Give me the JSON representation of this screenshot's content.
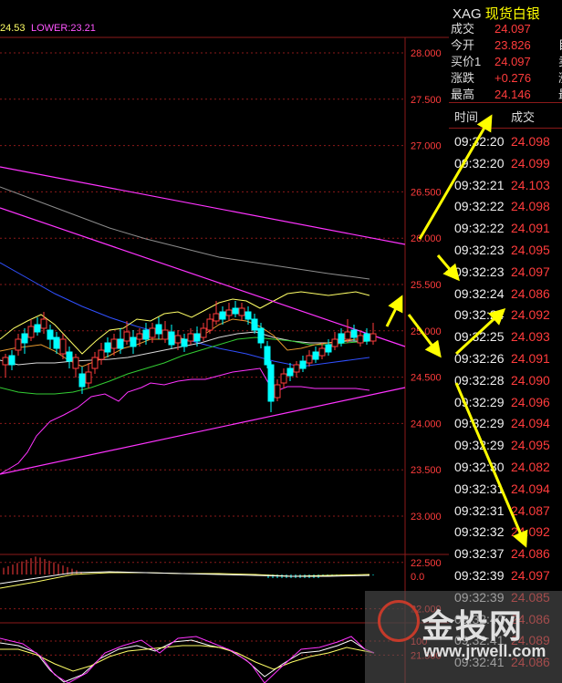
{
  "chart_top": {
    "ma_text_a": "24.53",
    "lower_text": "LOWER:23.21"
  },
  "price_axis": {
    "labels": [
      "28.000",
      "27.500",
      "27.000",
      "26.500",
      "26.000",
      "25.500",
      "25.000",
      "24.500",
      "24.000",
      "23.500",
      "23.000",
      "22.500",
      "22.000",
      "21.500",
      "21.000"
    ]
  },
  "macd_axis": {
    "zero_label": "0.0"
  },
  "kdj_axis": {
    "top_label": "100"
  },
  "quote": {
    "symbol": "XAG",
    "name": "现货白银",
    "rows": [
      {
        "label": "成交",
        "value": "24.097",
        "extra": ""
      },
      {
        "label": "今开",
        "value": "23.826",
        "extra": "目"
      },
      {
        "label": "买价1",
        "value": "24.097",
        "extra": "卖"
      },
      {
        "label": "涨跌",
        "value": "+0.276",
        "extra": "涨"
      },
      {
        "label": "最高",
        "value": "24.146",
        "extra": "最"
      }
    ]
  },
  "ticks": {
    "col_time": "时间",
    "col_price": "成交",
    "rows": [
      {
        "time": "09:32:20",
        "price": "24.098"
      },
      {
        "time": "09:32:20",
        "price": "24.099"
      },
      {
        "time": "09:32:21",
        "price": "24.103"
      },
      {
        "time": "09:32:22",
        "price": "24.098"
      },
      {
        "time": "09:32:22",
        "price": "24.091"
      },
      {
        "time": "09:32:23",
        "price": "24.095"
      },
      {
        "time": "09:32:23",
        "price": "24.097"
      },
      {
        "time": "09:32:24",
        "price": "24.086"
      },
      {
        "time": "09:32:24",
        "price": "24.092"
      },
      {
        "time": "09:32:25",
        "price": "24.093"
      },
      {
        "time": "09:32:26",
        "price": "24.091"
      },
      {
        "time": "09:32:28",
        "price": "24.090"
      },
      {
        "time": "09:32:29",
        "price": "24.096"
      },
      {
        "time": "09:32:29",
        "price": "24.094"
      },
      {
        "time": "09:32:29",
        "price": "24.095"
      },
      {
        "time": "09:32:30",
        "price": "24.082"
      },
      {
        "time": "09:32:31",
        "price": "24.094"
      },
      {
        "time": "09:32:31",
        "price": "24.087"
      },
      {
        "time": "09:32:32",
        "price": "24.092"
      },
      {
        "time": "09:32:37",
        "price": "24.086"
      },
      {
        "time": "09:32:39",
        "price": "24.097"
      },
      {
        "time": "09:32:39",
        "price": "24.085"
      },
      {
        "time": "09:32:40",
        "price": "24.086"
      },
      {
        "time": "09:32:41",
        "price": "24.089"
      },
      {
        "time": "09:32:41",
        "price": "24.086"
      }
    ]
  },
  "watermark": {
    "brand": "金投网",
    "url": "www.jrwell.com"
  },
  "colors": {
    "up": "#ff3c3c",
    "down": "#00ffff",
    "grid": "#8b1a1a",
    "trendline": "#ff33ff",
    "annotation_arrow": "#ffff00"
  }
}
